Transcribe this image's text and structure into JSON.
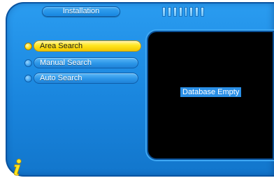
{
  "header": {
    "title": "Installation",
    "signal_segments": 8
  },
  "menu": {
    "items": [
      {
        "label": "Area Search",
        "selected": true
      },
      {
        "label": "Manual Search",
        "selected": false
      },
      {
        "label": "Auto Search",
        "selected": false
      }
    ]
  },
  "preview": {
    "status_text": "Database Empty"
  },
  "footer": {
    "icon": "info-icon"
  },
  "colors": {
    "frame_blue": "#1a86de",
    "selected_yellow": "#ffe51e",
    "preview_background": "#000000",
    "label_highlight": "#2a8fe6"
  }
}
